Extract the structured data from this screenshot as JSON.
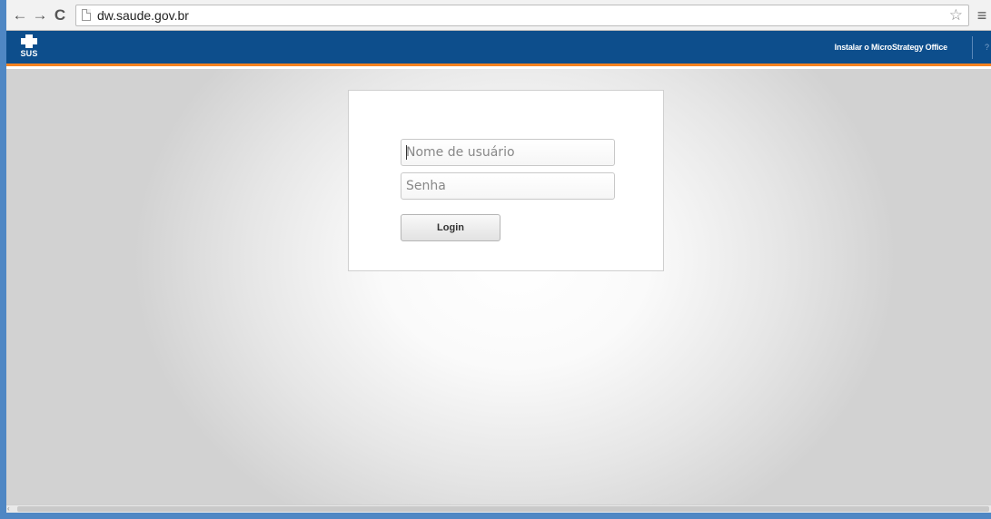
{
  "browser": {
    "back_glyph": "←",
    "forward_glyph": "→",
    "reload_glyph": "C",
    "url": "dw.saude.gov.br",
    "star_glyph": "☆",
    "menu_glyph": "≡"
  },
  "header": {
    "logo_text": "SUS",
    "install_link": "Instalar o MicroStrategy Office",
    "help_text": "?",
    "bg_color": "#0d4e8c",
    "accent_color": "#f58220"
  },
  "login": {
    "username_placeholder": "Nome de usuário",
    "password_placeholder": "Senha",
    "button_label": "Login"
  }
}
